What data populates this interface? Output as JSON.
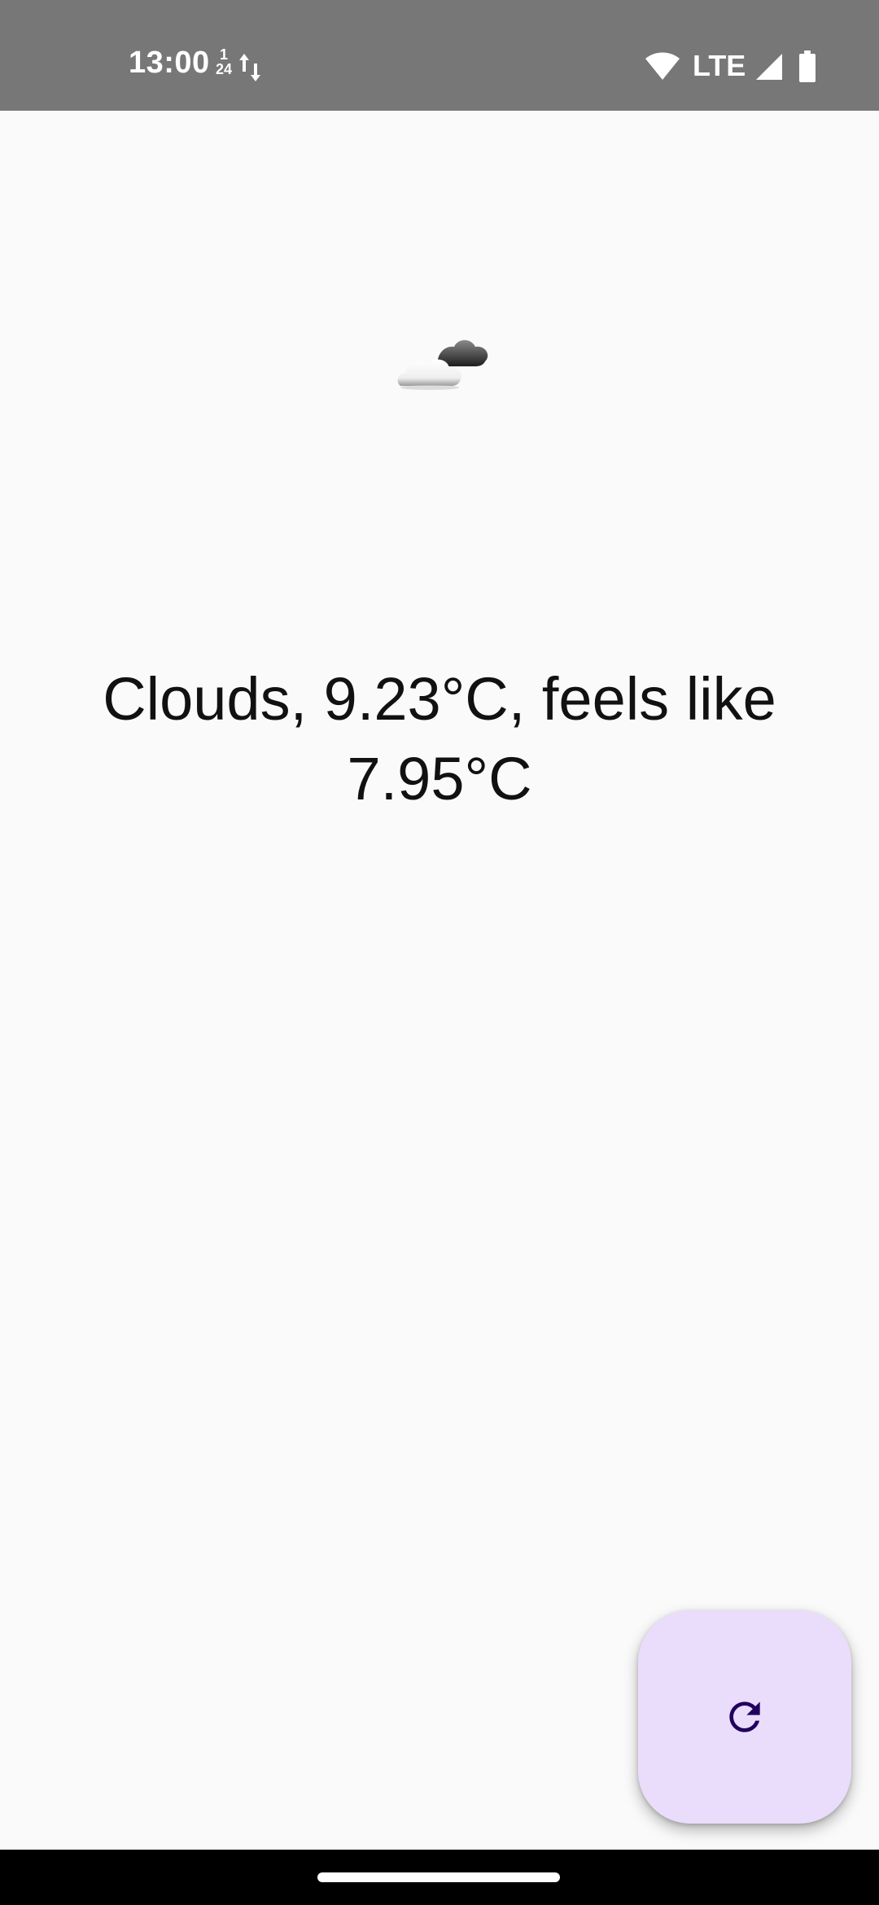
{
  "status_bar": {
    "time": "13:00",
    "date_top": "1",
    "date_bottom": "24",
    "network": "LTE",
    "background": "#777777"
  },
  "weather": {
    "icon": "cloud-icon",
    "line1": "Clouds, 9.23°C, feels like",
    "line2": "7.95°C"
  },
  "fab": {
    "icon": "refresh-icon",
    "background": "#eaddfb",
    "icon_color": "#21005d"
  }
}
